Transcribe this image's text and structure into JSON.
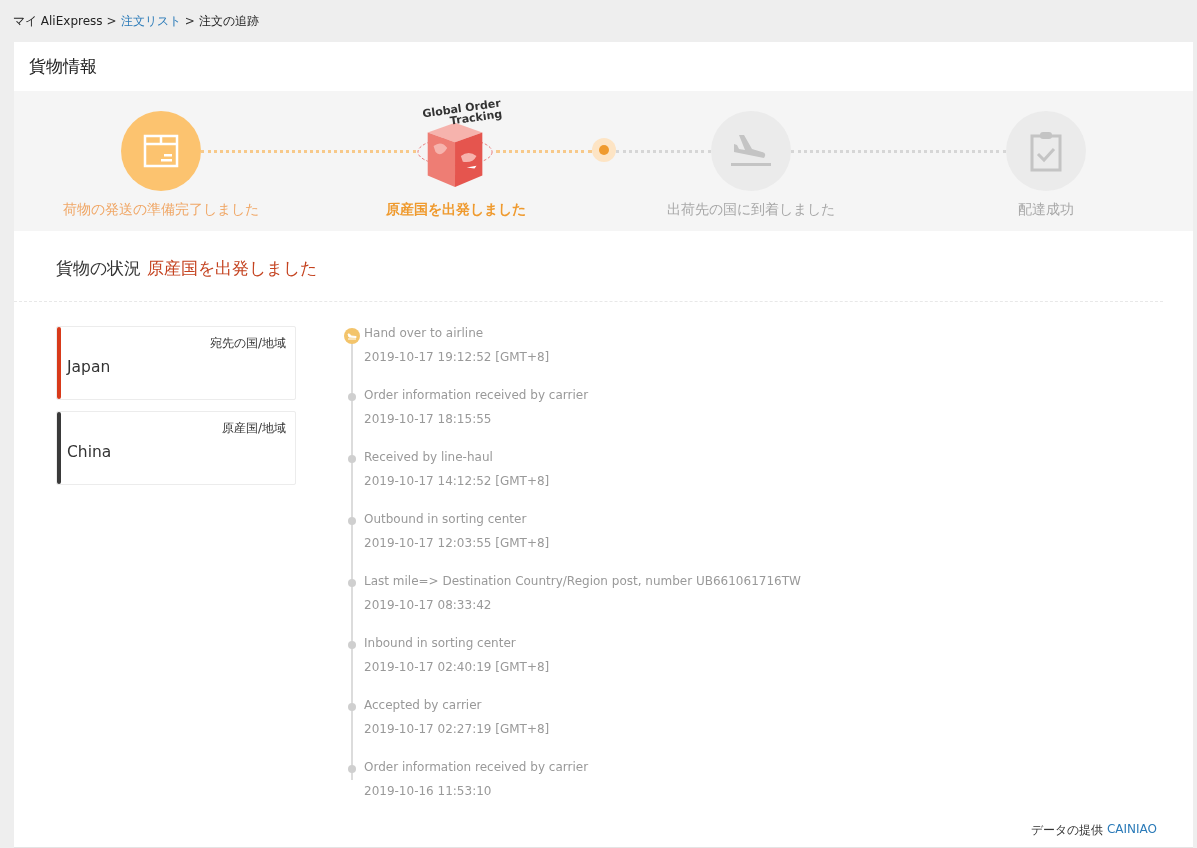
{
  "breadcrumb": [
    {
      "label": "マイ AliExpress",
      "link": false
    },
    {
      "label": "注文リスト",
      "link": true
    },
    {
      "label": "注文の追跡",
      "link": false
    }
  ],
  "breadcrumb_separator": ">",
  "panel_title": "貨物情報",
  "steps": [
    {
      "label": "荷物の発送の準備完了しました",
      "kind": "box",
      "reached": true,
      "current": false
    },
    {
      "label": "原産国を出発しました",
      "kind": "cube",
      "reached": true,
      "current": true,
      "badge_lines": [
        "Global Order",
        "Tracking"
      ]
    },
    {
      "label": "出荷先の国に到着しました",
      "kind": "landing",
      "reached": false,
      "current": false
    },
    {
      "label": "配達成功",
      "kind": "clipboard",
      "reached": false,
      "current": false
    }
  ],
  "status_label": "貨物の状況",
  "status_value": "原産国を出発しました",
  "countries": [
    {
      "caption": "宛先の国/地域",
      "name": "Japan",
      "color": "#d83a1a"
    },
    {
      "caption": "原産国/地域",
      "name": "China",
      "color": "#3a3a3a"
    }
  ],
  "events": [
    {
      "kind": "plane",
      "title": "Hand over to airline",
      "time": "2019-10-17 19:12:52 [GMT+8]"
    },
    {
      "kind": "dot",
      "title": "Order information received by carrier",
      "time": "2019-10-17 18:15:55"
    },
    {
      "kind": "dot",
      "title": "Received by line-haul",
      "time": "2019-10-17 14:12:52 [GMT+8]"
    },
    {
      "kind": "dot",
      "title": "Outbound in sorting center",
      "time": "2019-10-17 12:03:55 [GMT+8]"
    },
    {
      "kind": "dot",
      "title": "Last mile=> Destination Country/Region post, number UB661061716TW",
      "time": "2019-10-17 08:33:42"
    },
    {
      "kind": "dot",
      "title": "Inbound in sorting center",
      "time": "2019-10-17 02:40:19 [GMT+8]"
    },
    {
      "kind": "dot",
      "title": "Accepted by carrier",
      "time": "2019-10-17 02:27:19 [GMT+8]"
    },
    {
      "kind": "dot",
      "title": "Order information received by carrier",
      "time": "2019-10-16 11:53:10"
    }
  ],
  "credit": {
    "label": "データの提供",
    "provider": "CAINIAO"
  }
}
